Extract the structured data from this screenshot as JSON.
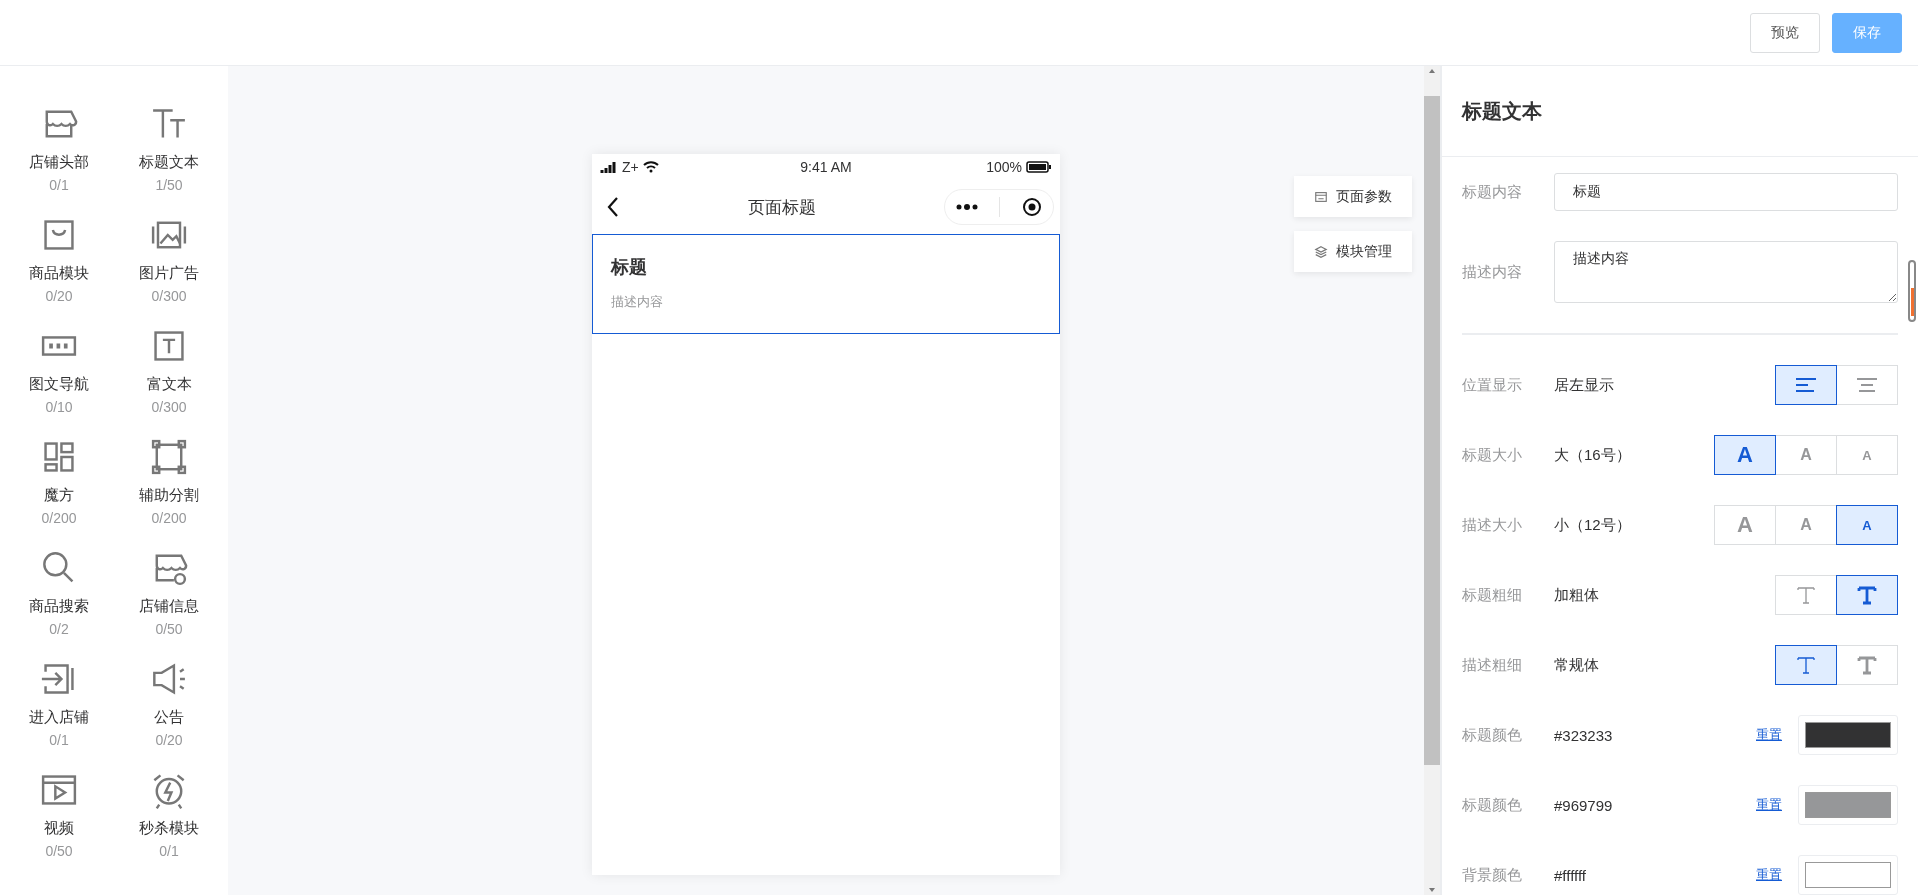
{
  "header": {
    "buttons": [
      {
        "label": "预览",
        "kind": "default"
      },
      {
        "label": "保存",
        "kind": "primary"
      }
    ]
  },
  "components": [
    {
      "label": "店铺头部",
      "count": "0/1"
    },
    {
      "label": "标题文本",
      "count": "1/50"
    },
    {
      "label": "商品模块",
      "count": "0/20"
    },
    {
      "label": "图片广告",
      "count": "0/300"
    },
    {
      "label": "图文导航",
      "count": "0/10"
    },
    {
      "label": "富文本",
      "count": "0/300"
    },
    {
      "label": "魔方",
      "count": "0/200"
    },
    {
      "label": "辅助分割",
      "count": "0/200"
    },
    {
      "label": "商品搜索",
      "count": "0/2"
    },
    {
      "label": "店铺信息",
      "count": "0/50"
    },
    {
      "label": "进入店铺",
      "count": "0/1"
    },
    {
      "label": "公告",
      "count": "0/20"
    },
    {
      "label": "视频",
      "count": "0/50"
    },
    {
      "label": "秒杀模块",
      "count": "0/1"
    }
  ],
  "phone": {
    "status_bar": {
      "carrier": "Z+",
      "time": "9:41 AM",
      "battery": "100%"
    },
    "nav_title": "页面标题",
    "block": {
      "title": "标题",
      "description": "描述内容",
      "selected": true
    }
  },
  "floating_buttons": [
    {
      "label": "页面参数",
      "kind": "page"
    },
    {
      "label": "模块管理",
      "kind": "layers"
    }
  ],
  "panel": {
    "title": "标题文本",
    "fields": [
      {
        "kind": "text",
        "label": "标题内容",
        "value": "标题"
      },
      {
        "kind": "textarea",
        "label": "描述内容",
        "value": "描述内容"
      }
    ],
    "settings": [
      {
        "kind": "segmented",
        "label": "位置显示",
        "value": "居左显示",
        "options": [
          {
            "kind": "align-left",
            "selected": true
          },
          {
            "kind": "align-center",
            "selected": false
          }
        ]
      },
      {
        "kind": "segmented",
        "label": "标题大小",
        "value": "大（16号）",
        "options": [
          {
            "kind": "size-large",
            "text": "A",
            "selected": true
          },
          {
            "kind": "size-medium",
            "text": "A",
            "selected": false
          },
          {
            "kind": "size-small",
            "text": "A",
            "selected": false
          }
        ]
      },
      {
        "kind": "segmented",
        "label": "描述大小",
        "value": "小（12号）",
        "options": [
          {
            "kind": "size-large",
            "text": "A",
            "selected": false
          },
          {
            "kind": "size-medium",
            "text": "A",
            "selected": false
          },
          {
            "kind": "size-small",
            "text": "A",
            "selected": true
          }
        ]
      },
      {
        "kind": "segmented",
        "label": "标题粗细",
        "value": "加粗体",
        "options": [
          {
            "kind": "weight-normal",
            "selected": false
          },
          {
            "kind": "weight-bold",
            "selected": true
          }
        ]
      },
      {
        "kind": "segmented",
        "label": "描述粗细",
        "value": "常规体",
        "options": [
          {
            "kind": "weight-normal",
            "selected": true
          },
          {
            "kind": "weight-bold",
            "selected": false
          }
        ]
      },
      {
        "kind": "color",
        "label": "标题颜色",
        "value": "#323233",
        "reset": "重置",
        "color": "#323233"
      },
      {
        "kind": "color",
        "label": "标题颜色",
        "value": "#969799",
        "reset": "重置",
        "color": "#969799"
      },
      {
        "kind": "color",
        "label": "背景颜色",
        "value": "#ffffff",
        "reset": "重置",
        "color": "#ffffff"
      }
    ]
  }
}
